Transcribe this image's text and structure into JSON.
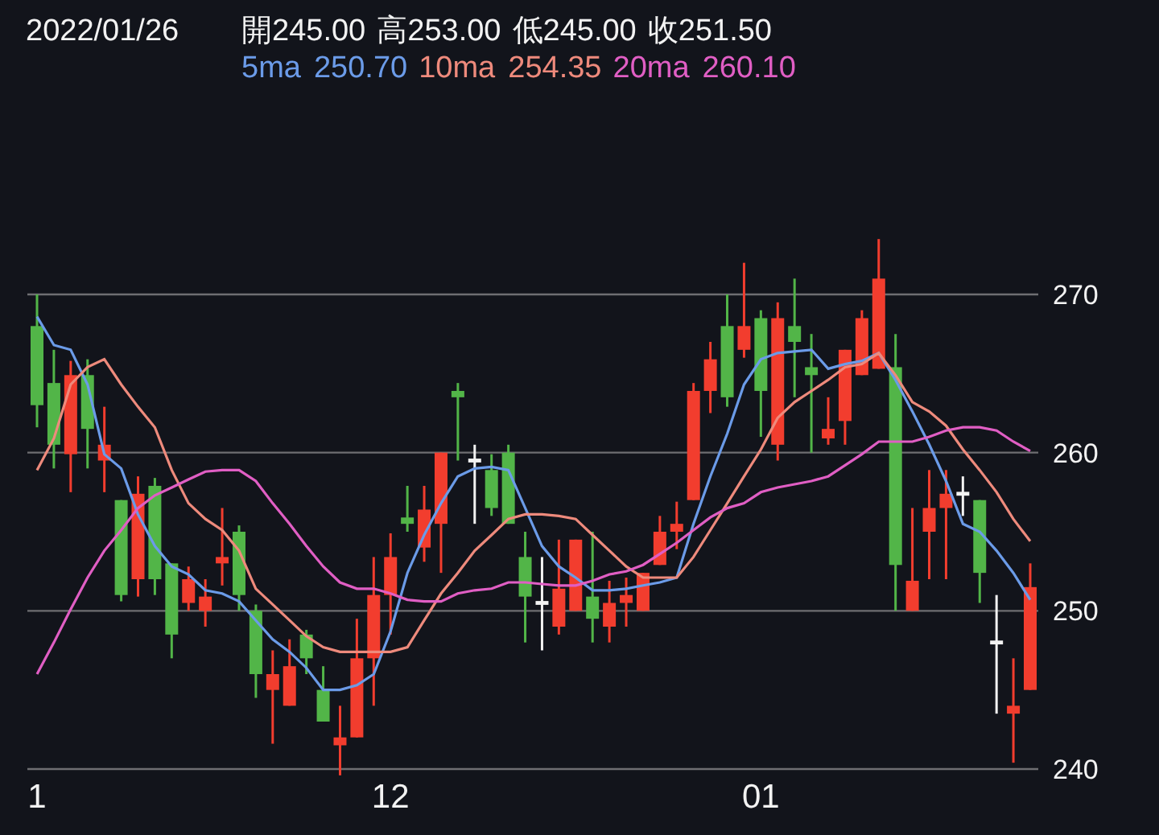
{
  "header": {
    "date": "2022/01/26",
    "ohlc": [
      {
        "label": "開",
        "value": "245.00"
      },
      {
        "label": "高",
        "value": "253.00"
      },
      {
        "label": "低",
        "value": "245.00"
      },
      {
        "label": "收",
        "value": "251.50"
      }
    ],
    "ma": [
      {
        "value": "250.70"
      },
      {
        "value": "254.35"
      },
      {
        "value": "260.10"
      }
    ]
  },
  "chart": {
    "chart_data": {
      "type": "candlestick",
      "grid": true,
      "ylim": [
        240,
        270
      ],
      "yticks": [
        240,
        250,
        260,
        270
      ],
      "categories": [
        "1",
        null,
        null,
        null,
        null,
        null,
        null,
        null,
        null,
        null,
        null,
        null,
        null,
        null,
        null,
        null,
        null,
        null,
        null,
        null,
        null,
        "12",
        null,
        null,
        null,
        null,
        null,
        null,
        null,
        null,
        null,
        null,
        null,
        null,
        null,
        null,
        null,
        null,
        null,
        null,
        null,
        null,
        null,
        "01",
        null,
        null,
        null,
        null,
        null,
        null,
        null,
        null,
        null,
        null,
        null,
        null,
        null,
        null,
        null,
        null
      ],
      "ohlc": [
        [
          268,
          270,
          261.6,
          263
        ],
        [
          264.4,
          266.5,
          259,
          260.5
        ],
        [
          259.9,
          265.8,
          257.5,
          264.9
        ],
        [
          264.9,
          265.9,
          259,
          261.5
        ],
        [
          259.5,
          262.9,
          257.5,
          260.5
        ],
        [
          257,
          257,
          250.6,
          251
        ],
        [
          252,
          258.5,
          250.9,
          257.4
        ],
        [
          257.9,
          258.4,
          251,
          252
        ],
        [
          253,
          253,
          247,
          248.5
        ],
        [
          250.5,
          252.8,
          250,
          252
        ],
        [
          250,
          252,
          249,
          250.9
        ],
        [
          253,
          256.5,
          251.6,
          253.4
        ],
        [
          255,
          255.4,
          250,
          251
        ],
        [
          250,
          250.4,
          244.5,
          246
        ],
        [
          245,
          247.5,
          241.6,
          246
        ],
        [
          244,
          248.2,
          244,
          246.5
        ],
        [
          248.5,
          248.8,
          246,
          247
        ],
        [
          245,
          246.5,
          243,
          243
        ],
        [
          241.5,
          244,
          239.6,
          242
        ],
        [
          242,
          249.5,
          242,
          247
        ],
        [
          247,
          253.4,
          244,
          251
        ],
        [
          251,
          254.9,
          248.5,
          253.4
        ],
        [
          255.9,
          257.9,
          255,
          255.5
        ],
        [
          254,
          257.9,
          253.1,
          256.4
        ],
        [
          255.5,
          260,
          252.4,
          260
        ],
        [
          263.9,
          264.4,
          259.5,
          263.5
        ],
        [
          259.5,
          260.5,
          255.5,
          259.5
        ],
        [
          258.9,
          259.9,
          256,
          256.5
        ],
        [
          260,
          260.5,
          255.5,
          255.5
        ],
        [
          253.4,
          255,
          248,
          250.9
        ],
        [
          250.5,
          253.4,
          247.5,
          250.5
        ],
        [
          249,
          254.5,
          248.5,
          251.4
        ],
        [
          250,
          254.5,
          250,
          254.5
        ],
        [
          250.9,
          255,
          248,
          249.5
        ],
        [
          249,
          251.9,
          248,
          250.5
        ],
        [
          250.5,
          252.1,
          249,
          251
        ],
        [
          250,
          252.4,
          250,
          252.4
        ],
        [
          252.9,
          256,
          252.9,
          255
        ],
        [
          255,
          256.9,
          253.9,
          255.5
        ],
        [
          257,
          264.4,
          257,
          263.9
        ],
        [
          263.9,
          267,
          262.5,
          265.9
        ],
        [
          268,
          270,
          262.9,
          263.5
        ],
        [
          266.5,
          272,
          266,
          268
        ],
        [
          268.5,
          269,
          261,
          263.9
        ],
        [
          260.5,
          269.5,
          259.5,
          268.5
        ],
        [
          268,
          271,
          263.5,
          267
        ],
        [
          265.4,
          267.5,
          260,
          264.9
        ],
        [
          260.9,
          263.5,
          260.5,
          261.5
        ],
        [
          262,
          266.5,
          260.5,
          266.5
        ],
        [
          264.9,
          269,
          264.9,
          268.5
        ],
        [
          265.3,
          273.5,
          265.3,
          271
        ],
        [
          265.4,
          267.5,
          250,
          252.9
        ],
        [
          250,
          256.5,
          250,
          251.9
        ],
        [
          255,
          258.9,
          252,
          256.5
        ],
        [
          256.5,
          258.9,
          252,
          257.4
        ],
        [
          257.4,
          258.5,
          256,
          257.4
        ],
        [
          257,
          257,
          250.5,
          252.4
        ],
        [
          248,
          251,
          243.5,
          248
        ],
        [
          243.5,
          247,
          240.4,
          244
        ],
        [
          245,
          253,
          245,
          251.5
        ]
      ]
    }
  },
  "moving_averages": {
    "chart_data": {
      "type": "line",
      "ylim": [
        240,
        270
      ],
      "series": [
        {
          "name": "5ma",
          "color": "#6b9be8",
          "values": [
            268.6,
            266.8,
            266.5,
            264.3,
            259.9,
            259,
            256.1,
            254.1,
            252.8,
            252.3,
            251.3,
            251.1,
            250.6,
            249.4,
            248.2,
            247.4,
            246.4,
            245,
            245,
            245.3,
            246,
            248.7,
            252.4,
            254.8,
            256.8,
            258.5,
            259,
            259.1,
            258.9,
            256.5,
            254.1,
            252.8,
            252.1,
            251.3,
            251.3,
            251.4,
            251.6,
            251.8,
            252.1,
            255.5,
            258.5,
            261.2,
            264.3,
            265.9,
            266.3,
            266.4,
            266.5,
            265.3,
            265.6,
            265.8,
            266.3,
            264.6,
            262.6,
            260.5,
            258.2,
            255.5,
            255,
            253.8,
            252.4,
            250.7
          ]
        },
        {
          "name": "10ma",
          "color": "#ee8a7c",
          "values": [
            258.9,
            260.9,
            264.3,
            265.4,
            265.9,
            264.3,
            262.9,
            261.6,
            258.9,
            256.8,
            255.8,
            255.1,
            253.8,
            251.4,
            250.4,
            249.4,
            248.4,
            247.7,
            247.4,
            247.4,
            247.4,
            247.4,
            247.7,
            249.4,
            251.1,
            252.4,
            253.8,
            254.8,
            255.8,
            256.1,
            256.1,
            256,
            255.8,
            254.8,
            253.8,
            252.8,
            252.1,
            252.1,
            252.1,
            253.4,
            255.1,
            256.8,
            258.5,
            260.2,
            262.2,
            263.2,
            263.9,
            264.6,
            265.4,
            265.6,
            266.3,
            264.9,
            263.2,
            262.6,
            261.7,
            260.2,
            258.9,
            257.5,
            255.8,
            254.4
          ]
        },
        {
          "name": "20ma",
          "color": "#e05ec4",
          "values": [
            246,
            248,
            250.1,
            252.1,
            253.8,
            255.1,
            256.5,
            257.3,
            257.8,
            258.3,
            258.8,
            258.9,
            258.9,
            258.2,
            256.8,
            255.5,
            254.1,
            252.8,
            251.8,
            251.4,
            251.4,
            251.1,
            250.7,
            250.6,
            250.6,
            251.1,
            251.3,
            251.4,
            251.8,
            251.8,
            251.7,
            251.6,
            251.6,
            251.9,
            252.3,
            252.5,
            252.9,
            253.6,
            254.3,
            255.1,
            255.9,
            256.5,
            256.8,
            257.5,
            257.8,
            258,
            258.2,
            258.5,
            259.2,
            259.9,
            260.7,
            260.7,
            260.7,
            261,
            261.4,
            261.6,
            261.6,
            261.4,
            260.7,
            260.1
          ]
        }
      ]
    }
  }
}
